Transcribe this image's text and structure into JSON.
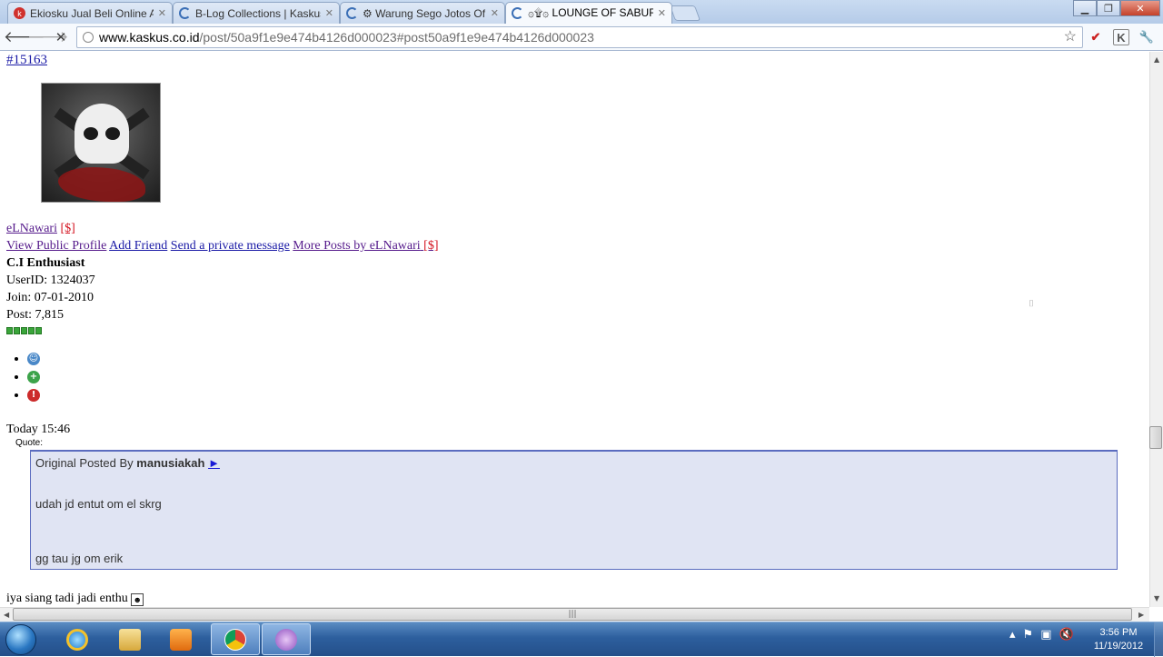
{
  "browser": {
    "tabs": [
      {
        "title": "Ekiosku Jual Beli Online Am",
        "favicon": "kaskus-red-icon",
        "active": false
      },
      {
        "title": "B-Log Collections | Kaskus -",
        "favicon": "loading-spinner-icon",
        "active": false
      },
      {
        "title": "⚙ Warung Sego Jotos Of R",
        "favicon": "loading-spinner-icon",
        "active": false
      },
      {
        "title": "۞۩۞ LOUNGE OF SABURAI",
        "favicon": "loading-spinner-icon",
        "active": true
      }
    ],
    "url_host": "www.kaskus.co.id",
    "url_rest": "/post/50a9f1e9e474b4126d000023#post50a9f1e9e474b4126d000023"
  },
  "post": {
    "number": "#15163",
    "username": "eLNawari",
    "user_badge": "[$]",
    "links": {
      "view_profile": "View Public Profile",
      "add_friend": "Add Friend",
      "private_message": "Send a private message",
      "more_posts": "More Posts by eLNawari",
      "more_posts_badge": "[$]"
    },
    "rank": "C.I Enthusiast",
    "user_id": "UserID: 1324037",
    "join": "Join: 07-01-2010",
    "posts": "Post: 7,815",
    "reputation_stars": 5,
    "timestamp": "Today 15:46",
    "quote": {
      "label": "Quote:",
      "posted_by_prefix": "Original Posted By",
      "author": "manusiakah",
      "arrow": "►",
      "line1": "udah jd entut om el skrg",
      "line2": "gg tau jg om erik"
    },
    "reply": "iya siang tadi jadi enthu"
  },
  "taskbar": {
    "time": "3:56 PM",
    "date": "11/19/2012"
  }
}
